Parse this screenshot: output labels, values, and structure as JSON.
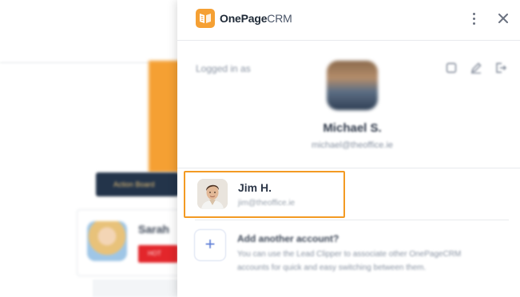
{
  "background_app": {
    "button_label": "Action Board",
    "card_name": "Sarah",
    "card_tag": "HOT"
  },
  "panel": {
    "brand_bold": "OnePage",
    "brand_light": "CRM",
    "logged_in_label": "Logged in as",
    "current_user": {
      "name": "Michael S.",
      "email": "michael@theoffice.ie"
    },
    "accounts": [
      {
        "name": "Jim H.",
        "email": "jim@theoffice.ie"
      }
    ],
    "add_account": {
      "title": "Add another account?",
      "description": "You can use the Lead Clipper to associate other OnePageCRM accounts for quick and easy switching between them.",
      "icon": "+"
    }
  },
  "colors": {
    "accent": "#f39a23",
    "brand_orange": "#f5a033",
    "text": "#2d3748"
  }
}
